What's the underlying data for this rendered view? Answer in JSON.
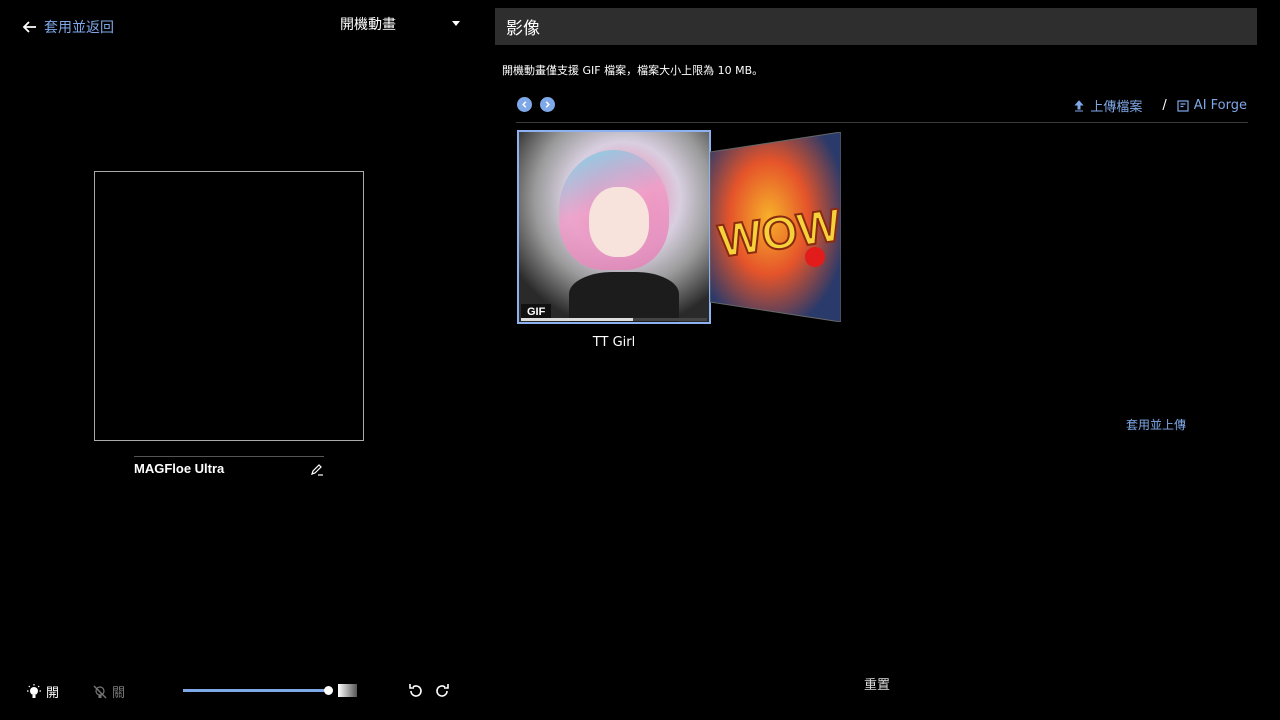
{
  "back_label": "套用並返回",
  "mode_select": {
    "selected": "開機動畫"
  },
  "device_name": "MAGFloe Ultra",
  "section_title": "影像",
  "note_text": "開機動畫僅支援 GIF 檔案，檔案大小上限為 10 MB。",
  "toolbar": {
    "upload_label": "上傳檔案",
    "separator": "/",
    "ai_forge_label": "AI Forge"
  },
  "gallery": [
    {
      "label": "TT Girl",
      "badge": "GIF",
      "selected": true,
      "progress": 0.6
    },
    {
      "label": "",
      "art_text": "WOW!"
    }
  ],
  "apply_upload_label": "套用並上傳",
  "reset_label": "重置",
  "light": {
    "on_label": "開",
    "off_label": "關",
    "level": 1.0
  },
  "colors": {
    "accent": "#7fa8e8",
    "header_bg": "#2e2e2e",
    "selection": "#8eb2f0"
  }
}
